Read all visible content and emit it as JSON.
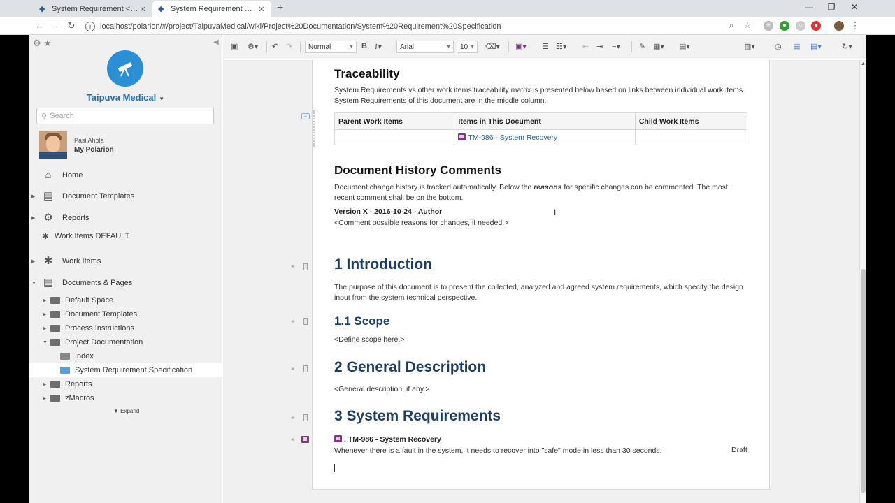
{
  "browser": {
    "tabs": [
      {
        "title": "System Requirement < Work Ite...",
        "active": false
      },
      {
        "title": "System Requirement Specificatio...",
        "active": true
      }
    ],
    "url": "localhost/polarion/#/project/TaipuvaMedical/wiki/Project%20Documentation/System%20Requirement%20Specification"
  },
  "sidebar": {
    "project_name": "Taipuva Medical",
    "search_placeholder": "Search",
    "user": {
      "name": "Pasi Ahola",
      "link": "My Polarion"
    },
    "nav": [
      {
        "label": "Home",
        "icon": "home-icon"
      },
      {
        "label": "Document Templates",
        "icon": "templates-icon"
      },
      {
        "label": "Reports",
        "icon": "gear-icon"
      },
      {
        "label": "Work Items DEFAULT",
        "icon": "puzzle-icon"
      },
      {
        "label": "Work Items",
        "icon": "puzzle-icon"
      },
      {
        "label": "Documents & Pages",
        "icon": "documents-icon"
      }
    ],
    "tree": [
      {
        "label": "Default Space"
      },
      {
        "label": "Document Templates"
      },
      {
        "label": "Process Instructions"
      },
      {
        "label": "Project Documentation"
      },
      {
        "label": "Index"
      },
      {
        "label": "System Requirement Specification"
      },
      {
        "label": "Reports"
      },
      {
        "label": "zMacros"
      }
    ],
    "expand_label": "Expand"
  },
  "toolbar": {
    "style_value": "Normal",
    "font_value": "Arial",
    "size_value": "10"
  },
  "document": {
    "traceability_heading": "Traceability",
    "traceability_text": "System Requirements vs other work items traceability matrix is presented below based on links between individual work items. System Requirements of this document are in the middle column.",
    "matrix": {
      "headers": [
        "Parent Work Items",
        "Items in This Document",
        "Child Work Items"
      ],
      "row_item": "TM-986 - System Recovery"
    },
    "history_heading": "Document History Comments",
    "history_text_before": "Document change history is tracked automatically. Below the ",
    "history_text_emph": "reasons",
    "history_text_after": " for specific changes can be commented. The most recent comment shall be on the bottom.",
    "version_line": "Version X - 2016-10-24 - Author",
    "version_comment": "<Comment possible reasons for changes, if needed.>",
    "intro_heading": "1 Introduction",
    "intro_text": "The purpose of this document is to present the collected, analyzed and agreed system requirements, which specify the design input from the system technical perspective.",
    "scope_heading": "1.1 Scope",
    "scope_text": "<Define scope here.>",
    "general_heading": "2 General Description",
    "general_text": "<General description, if any.>",
    "sysreq_heading": "3 System Requirements",
    "req_title": ", TM-986 - System Recovery",
    "req_text": "Whenever there is a fault in the system, it needs to recover into \"safe\" mode in less than 30 seconds.",
    "req_status": "Draft"
  }
}
